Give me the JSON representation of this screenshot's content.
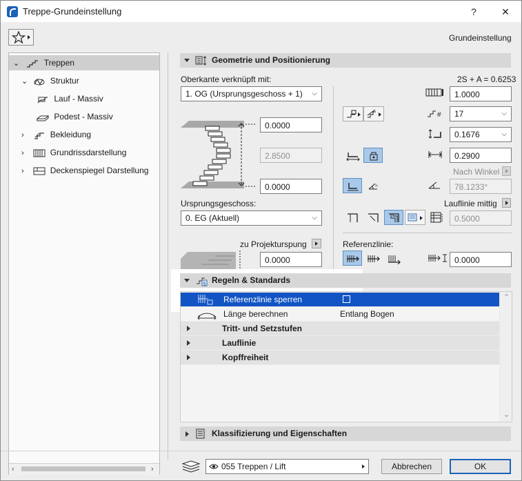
{
  "window": {
    "title": "Treppe-Grundeinstellung",
    "help": "?",
    "close": "✕",
    "subtitle": "Grundeinstellung"
  },
  "tree": [
    {
      "label": "Treppen"
    },
    {
      "label": "Struktur"
    },
    {
      "label": "Lauf - Massiv"
    },
    {
      "label": "Podest - Massiv"
    },
    {
      "label": "Bekleidung"
    },
    {
      "label": "Grundrissdarstellung"
    },
    {
      "label": "Deckenspiegel Darstellung"
    }
  ],
  "geometry": {
    "header": "Geometrie und Positionierung",
    "top_link_label": "Oberkante verknüpft mit:",
    "top_link_value": "1. OG (Ursprungsgeschoss + 1)",
    "formula": "2S + A = 0.6253",
    "top_offset": "0.0000",
    "height": "2.8500",
    "bottom_offset": "0.0000",
    "origin_label": "Ursprungsgeschoss:",
    "origin_value": "0. EG (Aktuell)",
    "project_origin_label": "zu Projekturspung",
    "project_origin_value": "0.0000",
    "width": "1.0000",
    "risers": "17",
    "riser_height": "0.1676",
    "tread_depth": "0.2900",
    "angle_label": "Nach Winkel",
    "angle_value": "78.1233°",
    "walkline_label": "Lauflinie mittig",
    "walkline_value": "0.5000",
    "ref_label": "Referenzlinie:",
    "ref_value": "0.0000"
  },
  "rules": {
    "header": "Regeln & Standards",
    "rows": [
      {
        "label": "Referenzlinie sperren",
        "value": ""
      },
      {
        "label": "Länge berechnen",
        "value": "Entlang Bogen"
      },
      {
        "label": "Tritt- und Setzstufen"
      },
      {
        "label": "Lauflinie"
      },
      {
        "label": "Kopffreiheit"
      }
    ]
  },
  "classification": {
    "header": "Klassifizierung und Eigenschaften"
  },
  "footer": {
    "layer": "055 Treppen / Lift",
    "cancel": "Abbrechen",
    "ok": "OK"
  },
  "colors": {
    "selection": "#1254c4",
    "accent": "#1c62b9",
    "section_bg": "#d7d7d7"
  }
}
